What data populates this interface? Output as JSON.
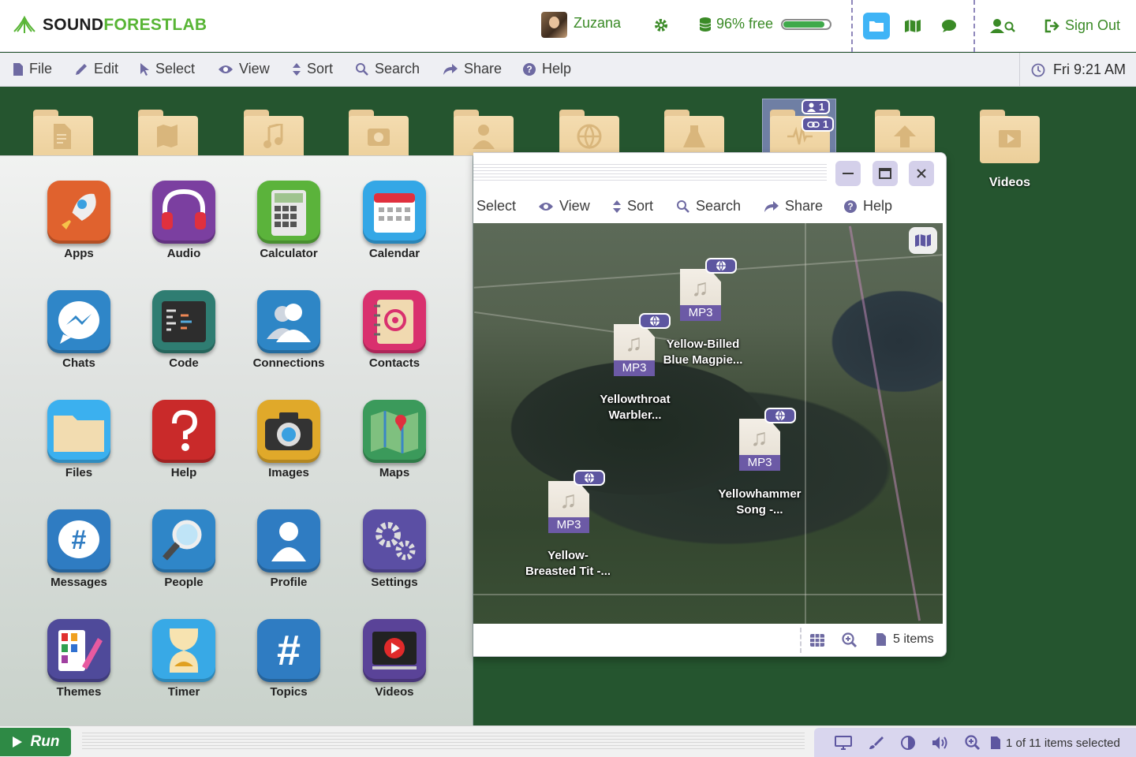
{
  "brand": {
    "part1": "SOUND",
    "part2": "FOREST",
    "part3": "LAB"
  },
  "user": {
    "name": "Zuzana"
  },
  "storage": {
    "label": "96% free",
    "fraction_used": 0.9
  },
  "signout": {
    "label": "Sign Out"
  },
  "menu": {
    "items": [
      "File",
      "Edit",
      "Select",
      "View",
      "Sort",
      "Search",
      "Share",
      "Help"
    ]
  },
  "clock": {
    "text": "Fri 9:21 AM"
  },
  "desktop": {
    "folders": [
      {
        "icon": "document-icon"
      },
      {
        "icon": "map-icon"
      },
      {
        "icon": "music-icon"
      },
      {
        "icon": "photo-icon"
      },
      {
        "icon": "person-icon"
      },
      {
        "icon": "globe-icon"
      },
      {
        "icon": "flask-icon"
      },
      {
        "icon": "waveform-icon"
      },
      {
        "icon": "upload-icon"
      },
      {
        "icon": "video-icon",
        "label": "Videos"
      }
    ],
    "selected_badges": {
      "shared": "1",
      "links": "1"
    }
  },
  "launcher": {
    "apps": [
      {
        "label": "Apps",
        "color": "#e0622e",
        "icon": "rocket-icon"
      },
      {
        "label": "Audio",
        "color": "#7b3fa0",
        "icon": "headphones-icon"
      },
      {
        "label": "Calculator",
        "color": "#5bb33b",
        "icon": "calculator-icon"
      },
      {
        "label": "Calendar",
        "color": "#34a7e6",
        "icon": "calendar-icon"
      },
      {
        "label": "Chats",
        "color": "#2f86c8",
        "icon": "messenger-icon"
      },
      {
        "label": "Code",
        "color": "#2f7d72",
        "icon": "code-icon"
      },
      {
        "label": "Connections",
        "color": "#2e86c6",
        "icon": "people-icon"
      },
      {
        "label": "Contacts",
        "color": "#d9306e",
        "icon": "address-book-icon"
      },
      {
        "label": "Files",
        "color": "#3bb0ef",
        "icon": "folder-icon"
      },
      {
        "label": "Help",
        "color": "#c92a2a",
        "icon": "question-icon"
      },
      {
        "label": "Images",
        "color": "#e0a92a",
        "icon": "camera-icon"
      },
      {
        "label": "Maps",
        "color": "#3b9a5b",
        "icon": "map-pin-icon"
      },
      {
        "label": "Messages",
        "color": "#2f7cc2",
        "icon": "hashtag-bubble-icon"
      },
      {
        "label": "People",
        "color": "#2f86c8",
        "icon": "magnifier-icon"
      },
      {
        "label": "Profile",
        "color": "#2f7cc2",
        "icon": "person-icon"
      },
      {
        "label": "Settings",
        "color": "#5b4fa4",
        "icon": "gears-icon"
      },
      {
        "label": "Themes",
        "color": "#4f4a9a",
        "icon": "palette-icon"
      },
      {
        "label": "Timer",
        "color": "#38a9e6",
        "icon": "hourglass-icon"
      },
      {
        "label": "Topics",
        "color": "#2f7cc2",
        "icon": "hashtag-icon"
      },
      {
        "label": "Videos",
        "color": "#5a4398",
        "icon": "play-icon"
      }
    ]
  },
  "window": {
    "menu": [
      "Select",
      "View",
      "Sort",
      "Search",
      "Share",
      "Help"
    ],
    "map_pins": [
      {
        "type": "MP3",
        "label_line1": "Yellow-Billed",
        "label_line2": "Blue Magpie..."
      },
      {
        "type": "MP3",
        "label_line1": "Yellowthroat",
        "label_line2": "Warbler..."
      },
      {
        "type": "MP3",
        "label_line1": "Yellowhammer",
        "label_line2": "Song -..."
      },
      {
        "type": "MP3",
        "label_line1": "Yellow-",
        "label_line2": "Breasted Tit -..."
      }
    ],
    "item_count": "5 items"
  },
  "taskbar": {
    "run_label": "Run",
    "status": "1 of 11 items selected"
  }
}
